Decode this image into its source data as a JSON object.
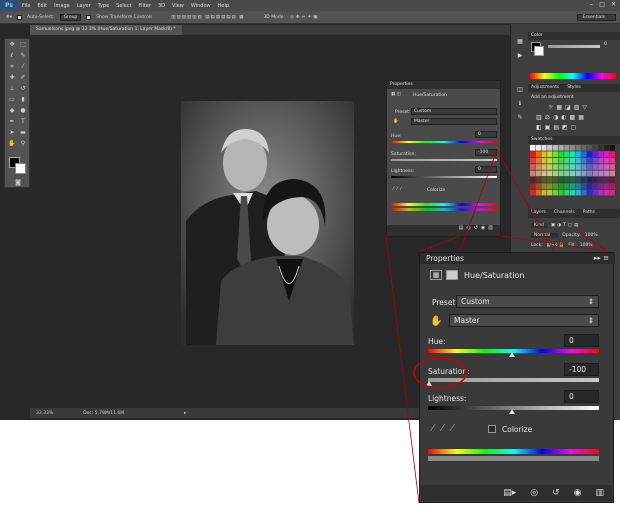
{
  "app": {
    "logo": "Ps"
  },
  "menu": [
    "File",
    "Edit",
    "Image",
    "Layer",
    "Type",
    "Select",
    "Filter",
    "3D",
    "View",
    "Window",
    "Help"
  ],
  "options_bar": {
    "auto_select": "Auto-Select:",
    "group": "Group",
    "show_transform": "Show Transform Controls",
    "mode_3d": "3D Mode:"
  },
  "workspace": "Essentials",
  "document_tab": "Samuelsons.jpeg @ 33.3% (Hue/Saturation 1, Layer Mask/8) *",
  "status": {
    "zoom": "33.33%",
    "doc": "Doc: 5.79M/11.6M"
  },
  "right_panel": {
    "color_tab": "Color",
    "swatches_tab": "Swatches",
    "adjustments_tabs": [
      "Adjustments",
      "Styles"
    ],
    "adjustments_hint": "Add an adjustment",
    "layers_tabs": [
      "Layers",
      "Channels",
      "Paths"
    ],
    "kind": "Kind",
    "blend_mode": "Normal",
    "opacity_label": "Opacity:",
    "opacity": "100%",
    "lock_label": "Lock:",
    "fill_label": "Fill:",
    "fill": "100%",
    "color_value": "0"
  },
  "mini_properties": {
    "title": "Properties",
    "panel": "Hue/Saturation",
    "preset_label": "Preset:",
    "preset": "Custom",
    "channel": "Master",
    "hue_label": "Hue:",
    "hue": "0",
    "saturation_label": "Saturation:",
    "saturation": "-100",
    "lightness_label": "Lightness:",
    "lightness": "0",
    "colorize": "Colorize"
  },
  "properties": {
    "title": "Properties",
    "panel": "Hue/Saturation",
    "preset_label": "Preset:",
    "preset": "Custom",
    "channel": "Master",
    "hue_label": "Hue:",
    "hue": "0",
    "saturation_label": "Saturation:",
    "saturation": "-100",
    "lightness_label": "Lightness:",
    "lightness": "0",
    "colorize": "Colorize",
    "icons": [
      "clip-to-layer-icon",
      "view-previous-icon",
      "reset-icon",
      "visibility-icon",
      "trash-icon"
    ]
  },
  "colors": {
    "accent_red": "#cc0000",
    "panel_bg": "#3a3a3a"
  }
}
